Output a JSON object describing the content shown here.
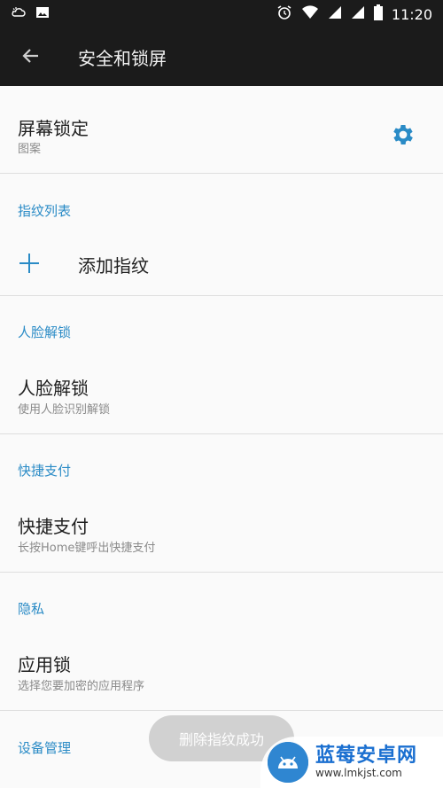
{
  "status_bar": {
    "time": "11:20",
    "icons_left": [
      "weather-icon",
      "image-icon"
    ],
    "icons_right": [
      "alarm-icon",
      "wifi-icon",
      "signal-icon",
      "signal2-icon",
      "battery-icon"
    ]
  },
  "app_bar": {
    "title": "安全和锁屏",
    "back_icon": "back-arrow-icon"
  },
  "screen_lock": {
    "title": "屏幕锁定",
    "subtitle": "图案",
    "icon": "gear-icon"
  },
  "fingerprint": {
    "section_title": "指纹列表",
    "add_label": "添加指纹",
    "add_icon": "plus-icon"
  },
  "face_unlock": {
    "section_title": "人脸解锁",
    "title": "人脸解锁",
    "subtitle": "使用人脸识别解锁"
  },
  "quick_pay": {
    "section_title": "快捷支付",
    "title": "快捷支付",
    "subtitle": "长按Home键呼出快捷支付"
  },
  "privacy": {
    "section_title": "隐私",
    "title": "应用锁",
    "subtitle": "选择您要加密的应用程序"
  },
  "device_admin": {
    "section_title": "设备管理"
  },
  "toast": {
    "text": "删除指纹成功"
  },
  "watermark": {
    "main": "蓝莓安卓网",
    "url": "www.lmkjst.com"
  },
  "colors": {
    "accent": "#2a8bc6",
    "appbar": "#1b1b1b",
    "background": "#fafafa"
  }
}
